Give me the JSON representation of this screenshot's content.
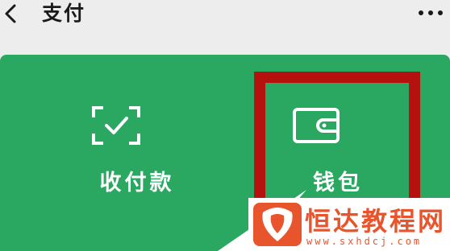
{
  "header": {
    "title": "支付"
  },
  "tiles": [
    {
      "label": "收付款",
      "icon": "scan-check-icon"
    },
    {
      "label": "钱包",
      "icon": "wallet-icon"
    }
  ],
  "colors": {
    "panel": "#2aa760",
    "highlight": "#b5120f",
    "watermark": "#e8552d"
  },
  "watermark": {
    "title": "恒达教程网",
    "url": "www.sxhdcj.com"
  }
}
